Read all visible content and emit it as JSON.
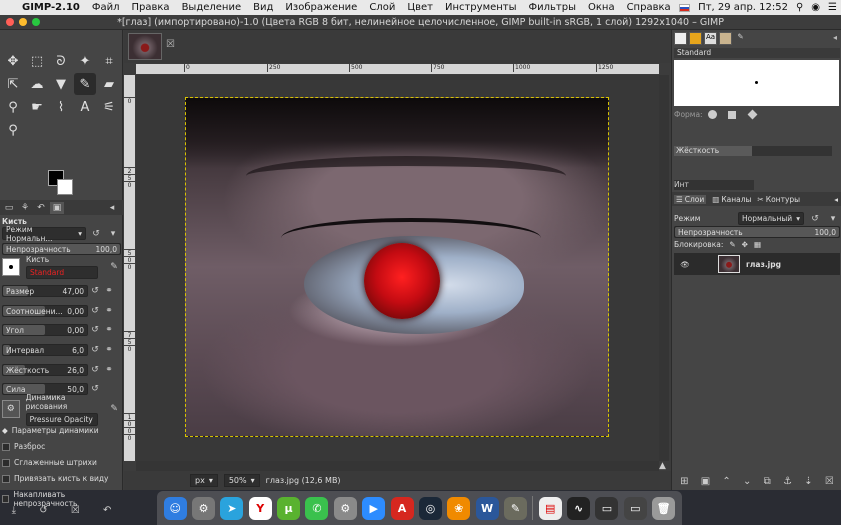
{
  "menubar": {
    "app_name": "GIMP-2.10",
    "items": [
      "Файл",
      "Правка",
      "Выделение",
      "Вид",
      "Изображение",
      "Слой",
      "Цвет",
      "Инструменты",
      "Фильтры",
      "Окна",
      "Справка"
    ],
    "clock": "Пт, 29 апр. 12:52"
  },
  "window": {
    "title": "*[глаз] (импортировано)-1.0 (Цвета RGB 8 бит, нелинейное целочисленное, GIMP built-in sRGB, 1 слой) 1292x1040 – GIMP"
  },
  "toolbox": {
    "tools": [
      {
        "icon": "move-icon",
        "glyph": "✥"
      },
      {
        "icon": "rect-select-icon",
        "glyph": "⬚"
      },
      {
        "icon": "lasso-icon",
        "glyph": "ᘐ"
      },
      {
        "icon": "fuzzy-select-icon",
        "glyph": "✦"
      },
      {
        "icon": "crop-icon",
        "glyph": "⌗"
      },
      {
        "icon": "transform-icon",
        "glyph": "⇱"
      },
      {
        "icon": "warp-icon",
        "glyph": "☁"
      },
      {
        "icon": "bucket-fill-icon",
        "glyph": "▼"
      },
      {
        "icon": "paintbrush-icon",
        "glyph": "✎"
      },
      {
        "icon": "eraser-icon",
        "glyph": "▰"
      },
      {
        "icon": "clone-icon",
        "glyph": "⚲"
      },
      {
        "icon": "smudge-icon",
        "glyph": "☛"
      },
      {
        "icon": "paths-icon",
        "glyph": "⌇"
      },
      {
        "icon": "text-tool-icon",
        "glyph": "A"
      },
      {
        "icon": "color-picker-icon",
        "glyph": "⚟"
      },
      {
        "icon": "zoom-icon",
        "glyph": "⚲"
      }
    ],
    "options": {
      "title": "Кисть",
      "mode_label": "Режим",
      "mode_value": "Режим Нормальн...",
      "opacity_label": "Непрозрачность",
      "opacity_value": "100,0",
      "brush_label": "Кисть",
      "brush_name": "Standard",
      "size_label": "Размер",
      "size_value": "47,00",
      "ratio_label": "Соотношени...",
      "ratio_value": "0,00",
      "angle_label": "Угол",
      "angle_value": "0,00",
      "spacing_label": "Интервал",
      "spacing_value": "6,0",
      "hardness_label": "Жёсткость",
      "hardness_value": "26,0",
      "force_label": "Сила",
      "force_value": "50,0",
      "dynamics_label": "Динамика рисования",
      "dynamics_value": "Pressure Opacity",
      "dynamics_params": "Параметры динамики",
      "scatter": "Разброс",
      "smooth": "Сглаженные штрихи",
      "lock_brush": "Привязать кисть к виду",
      "incremental": "Накапливать непрозрачность"
    }
  },
  "canvas": {
    "ruler_h": [
      "0",
      "250",
      "500",
      "750",
      "1000",
      "1250"
    ],
    "ruler_v": [
      "0",
      "2",
      "5",
      "0",
      "5",
      "0",
      "0",
      "7",
      "5",
      "0",
      "1",
      "0",
      "0",
      "0"
    ],
    "unit": "px",
    "zoom": "50%",
    "status": "глаз.jpg (12,6 MB)"
  },
  "rightpanel": {
    "brush_name": "Standard",
    "shape_label": "Форма:",
    "hardness_label": "Жёсткость",
    "inter_label": "Инт",
    "tabs": {
      "layers": "Слои",
      "channels": "Каналы",
      "paths": "Контуры"
    },
    "mode_label": "Режим",
    "mode_value": "Нормальный",
    "opacity_label": "Непрозрачность",
    "opacity_value": "100,0",
    "lock_label": "Блокировка:",
    "layer_name": "глаз.jpg"
  },
  "colors": {
    "accent": "#d7c400",
    "pupil_red": "#e01515"
  },
  "dock": [
    {
      "name": "finder",
      "color": "#2f7de1",
      "glyph": "☺"
    },
    {
      "name": "launchpad",
      "color": "#777777",
      "glyph": "⚙"
    },
    {
      "name": "telegram",
      "color": "#2aa3dd",
      "glyph": "➤"
    },
    {
      "name": "yandex",
      "color": "#ffffff",
      "glyph": "Y"
    },
    {
      "name": "utorrent",
      "color": "#59b22f",
      "glyph": "μ"
    },
    {
      "name": "whatsapp",
      "color": "#3ac14d",
      "glyph": "✆"
    },
    {
      "name": "system-preferences",
      "color": "#8a8a8a",
      "glyph": "⚙"
    },
    {
      "name": "zoom",
      "color": "#2d8cff",
      "glyph": "▶"
    },
    {
      "name": "acrobat",
      "color": "#d6271f",
      "glyph": "A"
    },
    {
      "name": "steam",
      "color": "#1b2838",
      "glyph": "◎"
    },
    {
      "name": "fl-studio",
      "color": "#f08a00",
      "glyph": "❀"
    },
    {
      "name": "word",
      "color": "#2b579a",
      "glyph": "W"
    },
    {
      "name": "gimp",
      "color": "#6b6b5e",
      "glyph": "✎"
    },
    {
      "name": "preview",
      "color": "#eeeeee",
      "glyph": "▤"
    },
    {
      "name": "activity",
      "color": "#222222",
      "glyph": "∿"
    },
    {
      "name": "screenshot",
      "color": "#333333",
      "glyph": "▭"
    },
    {
      "name": "window",
      "color": "#444444",
      "glyph": "▭"
    },
    {
      "name": "trash",
      "color": "#9a9a9a",
      "glyph": "🗑"
    }
  ]
}
